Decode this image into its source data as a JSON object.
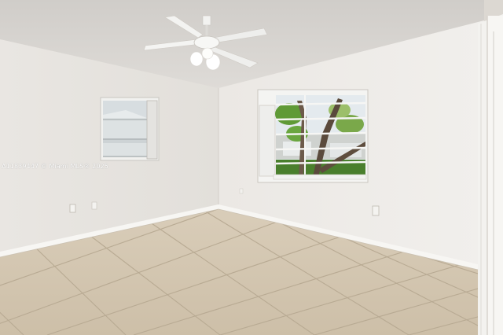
{
  "photo": {
    "subject": "empty bedroom with tile floor, two windows and ceiling fan",
    "watermark": "A11839447 © Miami MLS® 2025"
  },
  "colors": {
    "ceiling": "#d9d6d2",
    "wall_left": "#e6e3de",
    "wall_back": "#eceae6",
    "wall_right": "#f0eeea",
    "baseboard": "#f6f5f2",
    "floor": "#d3c6b1",
    "grout": "#b9ab95",
    "window_frame": "#f4f4f2",
    "foliage": "#4f8a2e",
    "sky": "#dfe6ea"
  }
}
